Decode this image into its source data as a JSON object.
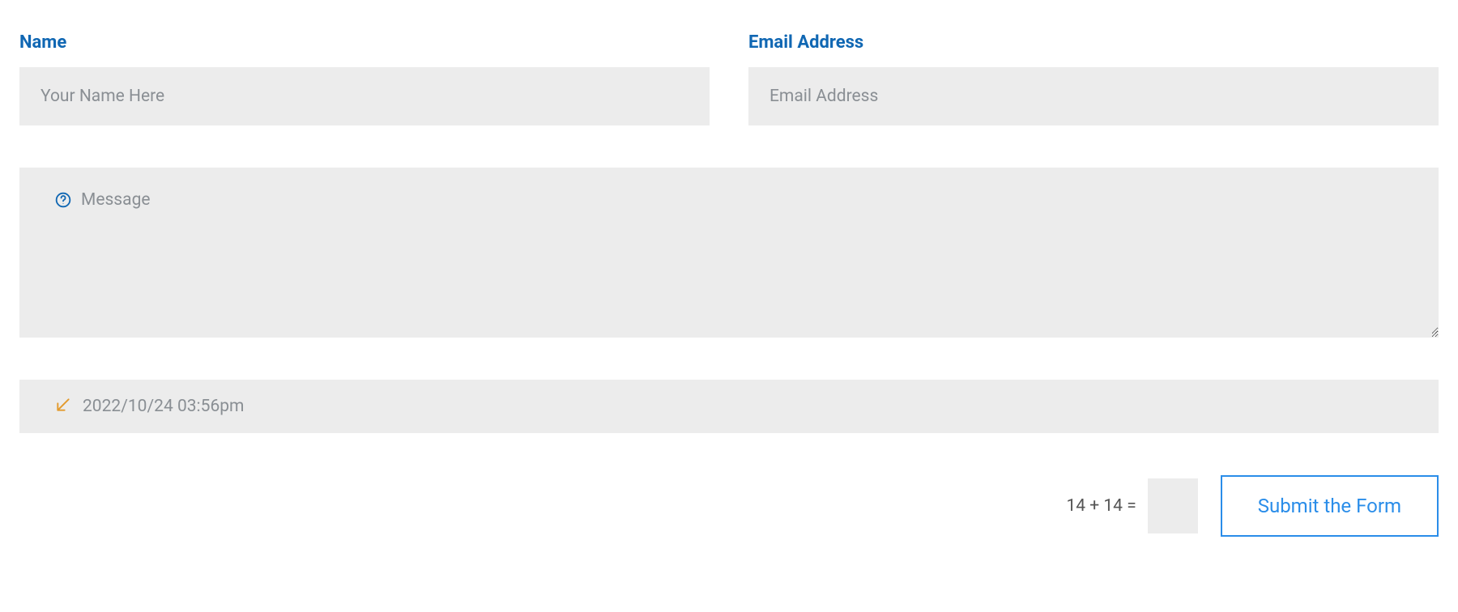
{
  "fields": {
    "name": {
      "label": "Name",
      "placeholder": "Your Name Here",
      "value": ""
    },
    "email": {
      "label": "Email Address",
      "placeholder": "Email Address",
      "value": ""
    },
    "message": {
      "placeholder": "Message",
      "value": ""
    },
    "datetime": {
      "value": "2022/10/24 03:56pm"
    }
  },
  "captcha": {
    "question": "14 + 14 =",
    "value": ""
  },
  "submit": {
    "label": "Submit the Form"
  },
  "icons": {
    "help": "help-circle-icon",
    "datetime": "arrow-down-right-box-icon"
  },
  "colors": {
    "accent": "#2a8de9",
    "labelBlue": "#1067b3",
    "fieldBg": "#ececec",
    "iconOrange": "#e39a2d"
  }
}
